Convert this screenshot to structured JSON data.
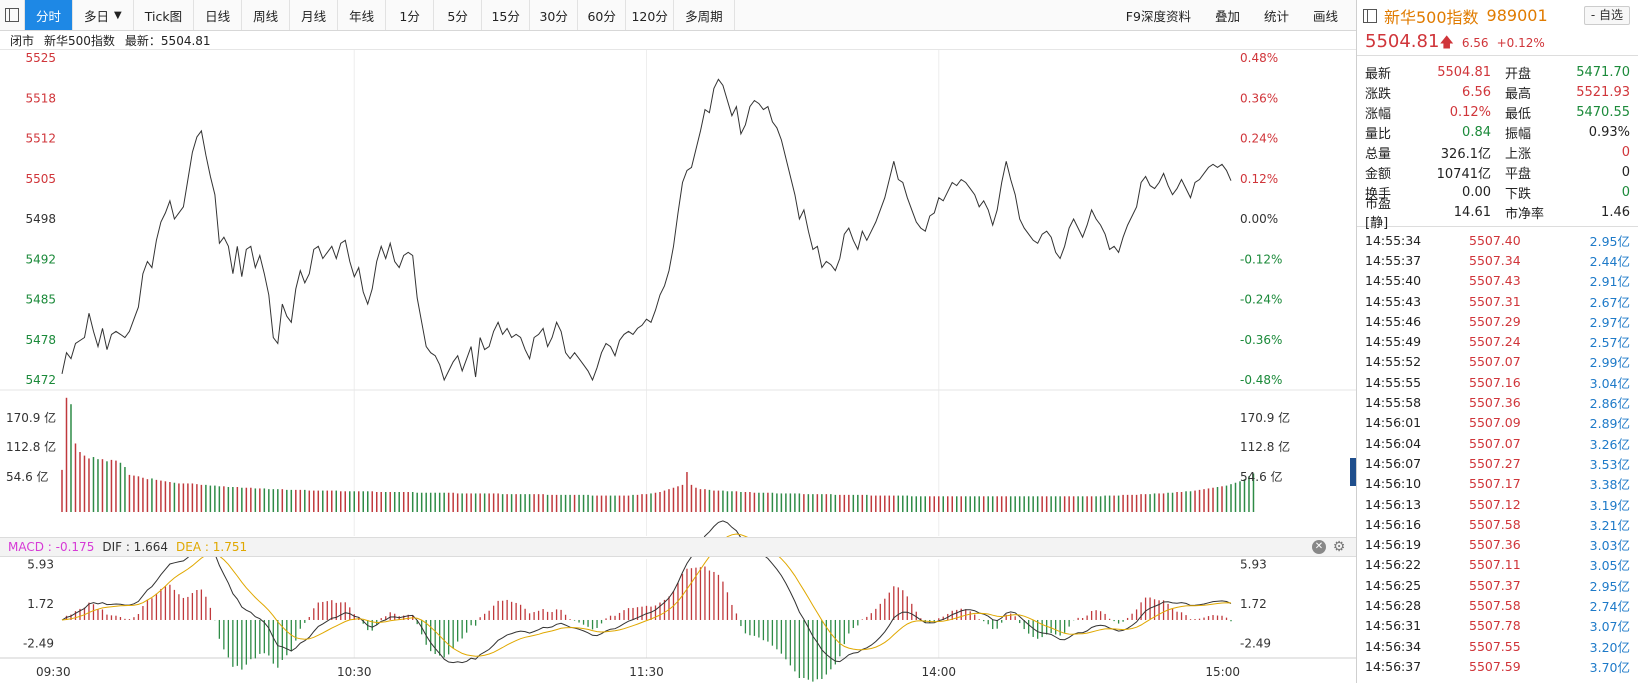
{
  "toolbar": {
    "tabs": [
      "分时",
      "多日",
      "Tick图",
      "日线",
      "周线",
      "月线",
      "年线",
      "1分",
      "5分",
      "15分",
      "30分",
      "60分",
      "120分",
      "多周期"
    ],
    "active": "分时",
    "right_tabs": [
      "F9深度资料",
      "叠加",
      "统计",
      "画线"
    ]
  },
  "status": {
    "state": "闭市",
    "name": "新华500指数",
    "latest_label": "最新：5504.81"
  },
  "left_axis": [
    "5525",
    "5518",
    "5512",
    "5505",
    "5498",
    "5492",
    "5485",
    "5478",
    "5472"
  ],
  "right_axis": [
    "0.48%",
    "0.36%",
    "0.24%",
    "0.12%",
    "0.00%",
    "-0.12%",
    "-0.24%",
    "-0.36%",
    "-0.48%"
  ],
  "volume_axis": [
    "170.9 亿",
    "112.8 亿",
    "54.6 亿"
  ],
  "macd": {
    "macd": "MACD : -0.175",
    "dif": "DIF : 1.664",
    "dea": "DEA : 1.751"
  },
  "macd_axis": [
    "5.93",
    "1.72",
    "-2.49"
  ],
  "time_axis": [
    "09:30",
    "10:30",
    "11:30",
    "14:00",
    "15:00"
  ],
  "colors": {
    "up": "#d0353a",
    "down": "#1b8a3a",
    "active_tab": "#1e88e5",
    "dea": "#e0a800",
    "name": "#e07b00"
  },
  "chart_data": {
    "type": "line",
    "ylim": [
      5472,
      5525
    ],
    "prev_close": 5498.25,
    "price": [
      5473.0,
      5476.5,
      5475.5,
      5478.0,
      5478.5,
      5479.0,
      5483.0,
      5480.0,
      5477.5,
      5480.5,
      5477.0,
      5479.5,
      5480.0,
      5479.5,
      5479.0,
      5480.0,
      5482.0,
      5484.0,
      5489.5,
      5491.5,
      5490.5,
      5495.0,
      5498.0,
      5499.5,
      5501.5,
      5498.5,
      5499.5,
      5500.5,
      5505.0,
      5509.5,
      5512.0,
      5513.0,
      5509.0,
      5505.5,
      5502.5,
      5494.5,
      5495.5,
      5494.0,
      5489.5,
      5494.0,
      5489.0,
      5493.5,
      5494.0,
      5490.5,
      5492.5,
      5489.5,
      5486.0,
      5479.0,
      5478.0,
      5484.5,
      5482.5,
      5481.5,
      5487.0,
      5490.0,
      5488.0,
      5489.5,
      5493.5,
      5494.0,
      5492.0,
      5493.0,
      5494.0,
      5492.0,
      5494.5,
      5495.0,
      5491.5,
      5489.0,
      5490.5,
      5486.5,
      5484.5,
      5487.0,
      5491.5,
      5494.0,
      5492.0,
      5494.5,
      5491.5,
      5490.5,
      5492.5,
      5493.0,
      5492.5,
      5485.5,
      5481.5,
      5477.5,
      5476.5,
      5476.0,
      5474.5,
      5472.0,
      5473.5,
      5475.0,
      5476.0,
      5473.5,
      5475.5,
      5477.5,
      5472.5,
      5479.0,
      5477.0,
      5477.5,
      5480.0,
      5481.5,
      5479.5,
      5480.5,
      5479.0,
      5479.5,
      5479.0,
      5477.0,
      5475.5,
      5479.0,
      5479.5,
      5480.5,
      5477.5,
      5479.0,
      5481.5,
      5480.0,
      5476.5,
      5475.5,
      5476.5,
      5475.5,
      5474.5,
      5473.5,
      5472.0,
      5474.0,
      5476.5,
      5478.0,
      5477.5,
      5476.0,
      5478.5,
      5479.5,
      5480.0,
      5479.5,
      5480.5,
      5481.0,
      5482.0,
      5481.5,
      5483.5,
      5486.0,
      5487.5,
      5490.0,
      5494.0,
      5499.5,
      5504.5,
      5506.5,
      5507.0,
      5510.0,
      5513.0,
      5516.5,
      5516.0,
      5520.0,
      5521.5,
      5520.5,
      5518.0,
      5515.5,
      5517.0,
      5512.5,
      5514.0,
      5517.0,
      5518.0,
      5517.5,
      5516.5,
      5517.0,
      5514.5,
      5513.5,
      5511.5,
      5508.5,
      5505.5,
      5502.5,
      5498.5,
      5500.0,
      5496.5,
      5493.5,
      5494.0,
      5490.5,
      5491.5,
      5491.0,
      5490.0,
      5492.0,
      5496.0,
      5497.0,
      5495.0,
      5493.5,
      5496.5,
      5495.0,
      5496.5,
      5498.0,
      5500.0,
      5502.0,
      5505.0,
      5508.0,
      5505.0,
      5504.5,
      5502.0,
      5500.0,
      5498.0,
      5497.0,
      5496.5,
      5499.0,
      5499.5,
      5502.0,
      5501.5,
      5503.0,
      5504.5,
      5504.0,
      5505.0,
      5504.5,
      5503.5,
      5502.5,
      5500.5,
      5501.5,
      5500.0,
      5497.5,
      5500.0,
      5504.5,
      5508.0,
      5505.0,
      5502.5,
      5498.5,
      5497.0,
      5496.0,
      5495.0,
      5494.5,
      5496.0,
      5496.5,
      5495.5,
      5493.0,
      5492.0,
      5494.0,
      5497.0,
      5498.5,
      5497.0,
      5495.5,
      5497.5,
      5500.0,
      5498.5,
      5497.5,
      5496.0,
      5493.5,
      5494.0,
      5493.0,
      5495.5,
      5497.5,
      5499.0,
      5500.5,
      5504.5,
      5505.5,
      5504.0,
      5503.5,
      5504.5,
      5506.0,
      5504.0,
      5502.5,
      5503.5,
      5505.0,
      5503.5,
      5502.0,
      5504.5,
      5505.0,
      5506.0,
      5507.0,
      5507.5,
      5507.0,
      5507.5,
      5506.5,
      5504.81
    ],
    "volume": [
      59,
      160,
      151,
      96,
      84,
      79,
      75,
      77,
      74,
      74,
      71,
      73,
      72,
      69,
      63,
      52,
      51,
      50,
      48,
      46,
      47,
      45,
      44,
      43,
      42,
      41,
      40,
      40,
      40,
      40,
      39,
      38,
      38,
      37,
      37,
      36,
      36,
      35,
      35,
      35,
      34,
      34,
      34,
      33,
      33,
      33,
      32,
      32,
      32,
      32,
      31,
      31,
      31,
      31,
      31,
      30,
      30,
      30,
      30,
      30,
      30,
      30,
      29,
      29,
      29,
      29,
      29,
      29,
      29,
      29,
      28,
      28,
      28,
      28,
      28,
      28,
      28,
      28,
      28,
      27,
      27,
      27,
      27,
      27,
      27,
      27,
      27,
      27,
      26,
      26,
      26,
      26,
      26,
      26,
      26,
      26,
      26,
      26,
      25,
      25,
      25,
      25,
      25,
      25,
      25,
      25,
      25,
      25,
      24,
      24,
      24,
      24,
      24,
      24,
      24,
      24,
      24,
      24,
      23,
      23,
      23,
      23,
      23,
      23,
      23,
      23,
      23,
      24,
      24,
      25,
      25,
      26,
      27,
      28,
      30,
      32,
      34,
      36,
      38,
      56,
      38,
      34,
      32,
      32,
      31,
      30,
      30,
      30,
      29,
      29,
      29,
      28,
      28,
      28,
      27,
      27,
      27,
      27,
      27,
      26,
      26,
      26,
      26,
      26,
      26,
      25,
      25,
      25,
      25,
      25,
      25,
      25,
      24,
      24,
      24,
      24,
      24,
      24,
      24,
      24,
      23,
      23,
      23,
      23,
      23,
      23,
      23,
      23,
      23,
      22,
      22,
      22,
      22,
      22,
      22,
      22,
      22,
      22,
      22,
      22,
      22,
      22,
      22,
      22,
      22,
      22,
      22,
      22,
      22,
      22,
      22,
      22,
      22,
      22,
      22,
      22,
      22,
      22,
      22,
      22,
      22,
      22,
      22,
      22,
      22,
      22,
      22,
      22,
      22,
      22,
      22,
      22,
      23,
      23,
      23,
      23,
      24,
      24,
      24,
      24,
      25,
      25,
      25,
      26,
      26,
      26,
      27,
      27,
      28,
      28,
      29,
      29,
      30,
      31,
      32,
      33,
      34,
      35,
      36,
      37,
      39,
      41,
      43,
      46,
      50,
      54
    ],
    "vmax": 170.9
  },
  "panel": {
    "name": "新华500指数",
    "code": "989001",
    "zixuan": "- 自选",
    "price": "5504.81",
    "arrow": "🡅",
    "change": "6.56",
    "pct": "+0.12%",
    "stats": [
      {
        "l1": "最新",
        "v1": "5504.81",
        "c1": "red",
        "l2": "开盘",
        "v2": "5471.70",
        "c2": "green"
      },
      {
        "l1": "涨跌",
        "v1": "6.56",
        "c1": "red",
        "l2": "最高",
        "v2": "5521.93",
        "c2": "red"
      },
      {
        "l1": "涨幅",
        "v1": "0.12%",
        "c1": "red",
        "l2": "最低",
        "v2": "5470.55",
        "c2": "green"
      },
      {
        "l1": "量比",
        "v1": "0.84",
        "c1": "green",
        "l2": "振幅",
        "v2": "0.93%",
        "c2": "black"
      },
      {
        "l1": "总量",
        "v1": "326.1亿",
        "c1": "black",
        "l2": "上涨",
        "v2": "0",
        "c2": "red"
      },
      {
        "l1": "金额",
        "v1": "10741亿",
        "c1": "black",
        "l2": "平盘",
        "v2": "0",
        "c2": "black"
      },
      {
        "l1": "换手",
        "v1": "0.00",
        "c1": "black",
        "l2": "下跌",
        "v2": "0",
        "c2": "green"
      },
      {
        "l1": "市盈[静]",
        "v1": "14.61",
        "c1": "black",
        "l2": "市净率",
        "v2": "1.46",
        "c2": "black"
      }
    ],
    "ticks": [
      {
        "t": "14:55:34",
        "p": "5507.40",
        "v": "2.95亿"
      },
      {
        "t": "14:55:37",
        "p": "5507.34",
        "v": "2.44亿"
      },
      {
        "t": "14:55:40",
        "p": "5507.43",
        "v": "2.91亿"
      },
      {
        "t": "14:55:43",
        "p": "5507.31",
        "v": "2.67亿"
      },
      {
        "t": "14:55:46",
        "p": "5507.29",
        "v": "2.97亿"
      },
      {
        "t": "14:55:49",
        "p": "5507.24",
        "v": "2.57亿"
      },
      {
        "t": "14:55:52",
        "p": "5507.07",
        "v": "2.99亿"
      },
      {
        "t": "14:55:55",
        "p": "5507.16",
        "v": "3.04亿"
      },
      {
        "t": "14:55:58",
        "p": "5507.36",
        "v": "2.86亿"
      },
      {
        "t": "14:56:01",
        "p": "5507.09",
        "v": "2.89亿"
      },
      {
        "t": "14:56:04",
        "p": "5507.07",
        "v": "3.26亿"
      },
      {
        "t": "14:56:07",
        "p": "5507.27",
        "v": "3.53亿"
      },
      {
        "t": "14:56:10",
        "p": "5507.17",
        "v": "3.38亿"
      },
      {
        "t": "14:56:13",
        "p": "5507.12",
        "v": "3.19亿"
      },
      {
        "t": "14:56:16",
        "p": "5507.58",
        "v": "3.21亿"
      },
      {
        "t": "14:56:19",
        "p": "5507.36",
        "v": "3.03亿"
      },
      {
        "t": "14:56:22",
        "p": "5507.11",
        "v": "3.05亿"
      },
      {
        "t": "14:56:25",
        "p": "5507.37",
        "v": "2.95亿"
      },
      {
        "t": "14:56:28",
        "p": "5507.58",
        "v": "2.74亿"
      },
      {
        "t": "14:56:31",
        "p": "5507.78",
        "v": "3.07亿"
      },
      {
        "t": "14:56:34",
        "p": "5507.55",
        "v": "3.20亿"
      },
      {
        "t": "14:56:37",
        "p": "5507.59",
        "v": "3.70亿"
      }
    ]
  }
}
